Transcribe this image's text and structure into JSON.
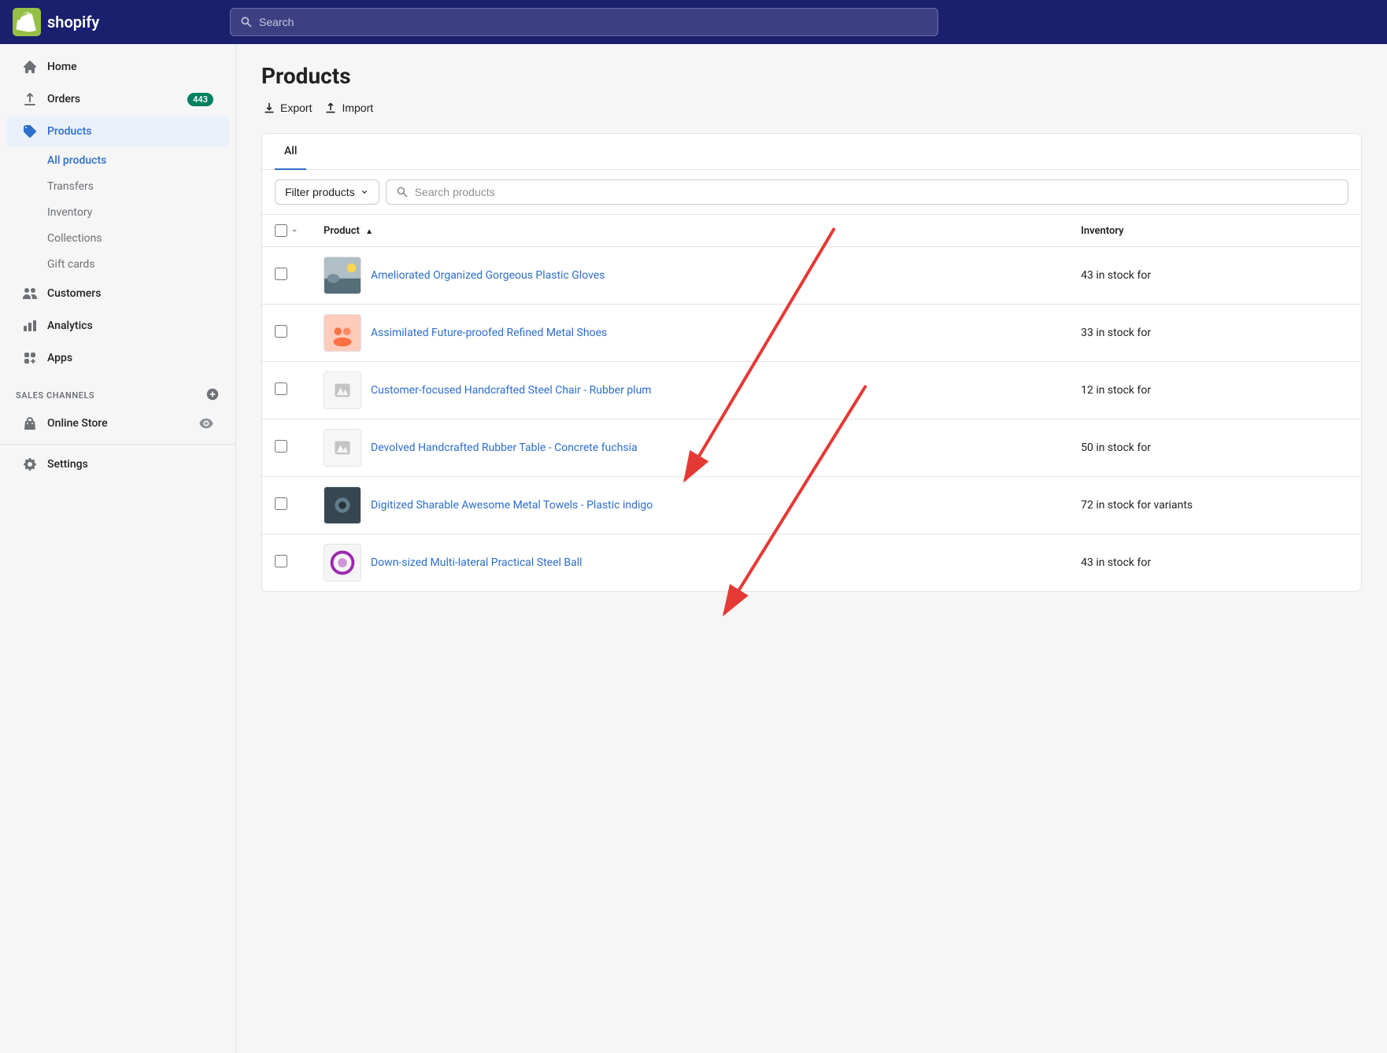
{
  "topbar": {
    "logo_text": "shopify",
    "search_placeholder": "Search"
  },
  "sidebar": {
    "nav_items": [
      {
        "id": "home",
        "label": "Home",
        "icon": "home"
      },
      {
        "id": "orders",
        "label": "Orders",
        "icon": "orders",
        "badge": "443"
      },
      {
        "id": "products",
        "label": "Products",
        "icon": "products",
        "active": true
      }
    ],
    "products_sub": [
      {
        "id": "all-products",
        "label": "All products",
        "active": true
      },
      {
        "id": "transfers",
        "label": "Transfers"
      },
      {
        "id": "inventory",
        "label": "Inventory"
      },
      {
        "id": "collections",
        "label": "Collections"
      },
      {
        "id": "gift-cards",
        "label": "Gift cards"
      }
    ],
    "main_nav": [
      {
        "id": "customers",
        "label": "Customers",
        "icon": "customers"
      },
      {
        "id": "analytics",
        "label": "Analytics",
        "icon": "analytics"
      },
      {
        "id": "apps",
        "label": "Apps",
        "icon": "apps"
      }
    ],
    "sales_channels_label": "SALES CHANNELS",
    "online_store_label": "Online Store",
    "settings_label": "Settings"
  },
  "page": {
    "title": "Products",
    "export_label": "Export",
    "import_label": "Import"
  },
  "tabs": [
    {
      "id": "all",
      "label": "All",
      "active": true
    }
  ],
  "filter": {
    "filter_label": "Filter products",
    "search_placeholder": "Search products"
  },
  "table": {
    "col_product": "Product",
    "col_inventory": "Inventory",
    "sort_icon": "▲",
    "rows": [
      {
        "id": 1,
        "name": "Ameliorated Organized Gorgeous Plastic Gloves",
        "inventory": "43 in stock for",
        "has_image": true,
        "image_type": "landscape"
      },
      {
        "id": 2,
        "name": "Assimilated Future-proofed Refined Metal Shoes",
        "inventory": "33 in stock for",
        "has_image": true,
        "image_type": "avatar"
      },
      {
        "id": 3,
        "name": "Customer-focused Handcrafted Steel Chair - Rubber plum",
        "inventory": "12 in stock for",
        "has_image": false,
        "image_type": "placeholder"
      },
      {
        "id": 4,
        "name": "Devolved Handcrafted Rubber Table - Concrete fuchsia",
        "inventory": "50 in stock for",
        "has_image": false,
        "image_type": "placeholder"
      },
      {
        "id": 5,
        "name": "Digitized Sharable Awesome Metal Towels - Plastic indigo",
        "inventory": "72 in stock for variants",
        "has_image": true,
        "image_type": "dark"
      },
      {
        "id": 6,
        "name": "Down-sized Multi-lateral Practical Steel Ball",
        "inventory": "43 in stock for",
        "has_image": true,
        "image_type": "ring"
      }
    ]
  },
  "colors": {
    "nav_bg": "#1a1f6e",
    "active_link": "#2c6ecb",
    "badge_bg": "#008060"
  }
}
